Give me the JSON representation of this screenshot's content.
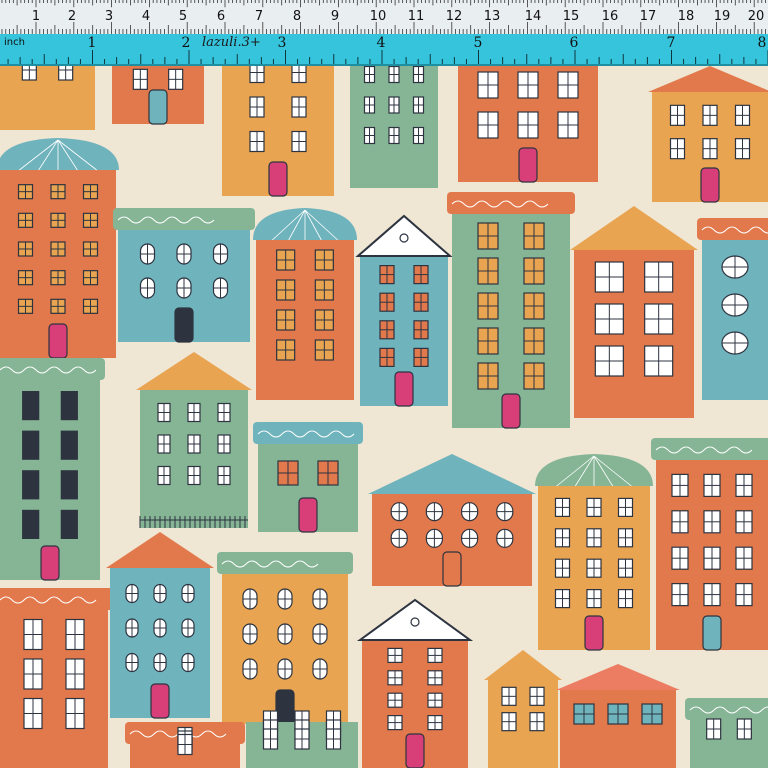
{
  "image": {
    "subject": "fabric swatch with a ruler",
    "palette": {
      "background": "#efe6d4",
      "orange": "#e2794c",
      "mustard": "#e9a452",
      "sage": "#86b596",
      "teal": "#6fb3bd",
      "pink": "#d83f78",
      "navy": "#2d3440",
      "ruler_blue": "#35c4dc"
    }
  },
  "ruler": {
    "cm_labels": [
      "1",
      "2",
      "3",
      "4",
      "5",
      "6",
      "7",
      "8",
      "9",
      "10",
      "11",
      "12",
      "13",
      "14",
      "15",
      "16",
      "17",
      "18",
      "19",
      "20"
    ],
    "inch_unit": "inch",
    "inch_labels": [
      "1",
      "2",
      "3",
      "4",
      "5",
      "6",
      "7",
      "8"
    ],
    "brand": "lazuli.3+"
  }
}
